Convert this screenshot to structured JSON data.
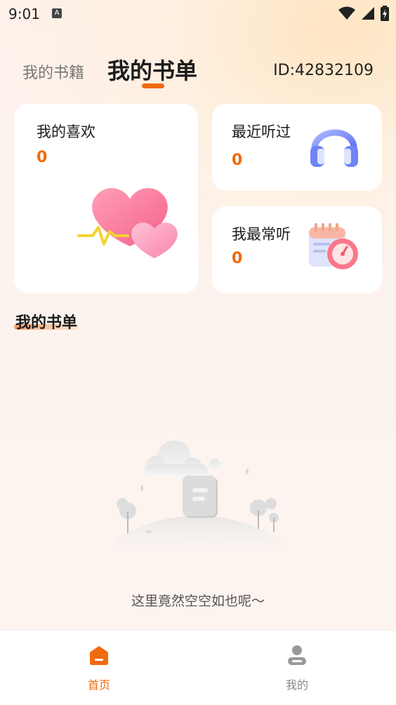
{
  "status_bar": {
    "time": "9:01",
    "badge": "A"
  },
  "header": {
    "tab_books": "我的书籍",
    "tab_lists": "我的书单",
    "user_id": "ID:42832109"
  },
  "cards": {
    "favorites": {
      "title": "我的喜欢",
      "count": "0",
      "icon": "hearts-icon"
    },
    "recent": {
      "title": "最近听过",
      "count": "0",
      "icon": "headphones-icon"
    },
    "most": {
      "title": "我最常听",
      "count": "0",
      "icon": "calendar-clock-icon"
    }
  },
  "section": {
    "title": "我的书单"
  },
  "empty_state": {
    "text": "这里竟然空空如也呢～"
  },
  "bottom_nav": [
    {
      "label": "首页",
      "icon": "home-icon",
      "active": true
    },
    {
      "label": "我的",
      "icon": "user-icon",
      "active": false
    }
  ],
  "colors": {
    "accent": "#f06a10",
    "background": "#fdf3ee"
  }
}
